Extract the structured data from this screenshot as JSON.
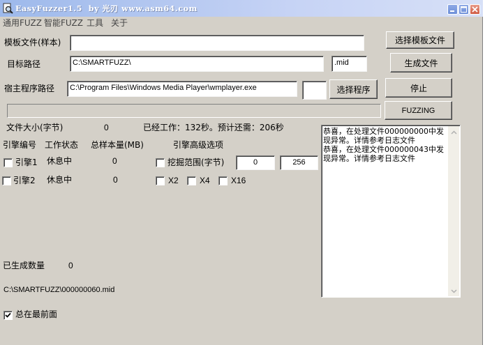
{
  "window": {
    "title": "EasyFuzzer1.5  by 光刃 www.asm64.com"
  },
  "menu": [
    "通用FUZZ",
    "智能FUZZ",
    "工具",
    "关于"
  ],
  "form": {
    "template_label": "模板文件(样本)",
    "template_value": "",
    "target_label": "目标路径",
    "target_value": "C:\\SMARTFUZZ\\",
    "extension_value": ".mid",
    "host_label": "宿主程序路径",
    "host_value": "C:\\Program Files\\Windows Media Player\\wmplayer.exe",
    "host_extra_value": ""
  },
  "buttons": {
    "select_template": "选择模板文件",
    "generate": "生成文件",
    "select_program": "选择程序",
    "stop": "停止",
    "fuzzing": "FUZZING"
  },
  "status": {
    "file_size_label": "文件大小(字节)",
    "file_size_value": "0",
    "progress_text": "已经工作：132秒。预计还需：206秒",
    "progress_fraction": 0
  },
  "engines": {
    "col_id": "引擎编号",
    "col_state": "工作状态",
    "col_total": "总样本量(MB)",
    "rows": [
      {
        "name": "引擎1",
        "state": "休息中",
        "total": "0",
        "checked": false
      },
      {
        "name": "引擎2",
        "state": "休息中",
        "total": "0",
        "checked": false
      }
    ]
  },
  "advanced": {
    "title": "引擎高级选项",
    "range_label": "挖掘范围(字节)",
    "range_start": "0",
    "range_end": "256",
    "multipliers": [
      "X2",
      "X4",
      "X16"
    ]
  },
  "log": {
    "text": "恭喜，在处理文件000000000中发现异常。详情参考日志文件\n恭喜，在处理文件000000043中发现异常。详情参考日志文件"
  },
  "footer": {
    "generated_label": "已生成数量",
    "generated_value": "0",
    "current_file": "C:\\SMARTFUZZ\\000000060.mid",
    "always_on_top_label": "总在最前面",
    "always_on_top_checked": true
  },
  "icons": {
    "app": "magnifier-doc-icon",
    "minimize": "minimize-icon",
    "maximize": "maximize-icon",
    "close": "close-icon"
  },
  "colors": {
    "face": "#d4d0c8",
    "titlebar": "#9db9eb",
    "close": "#cf5b45"
  }
}
